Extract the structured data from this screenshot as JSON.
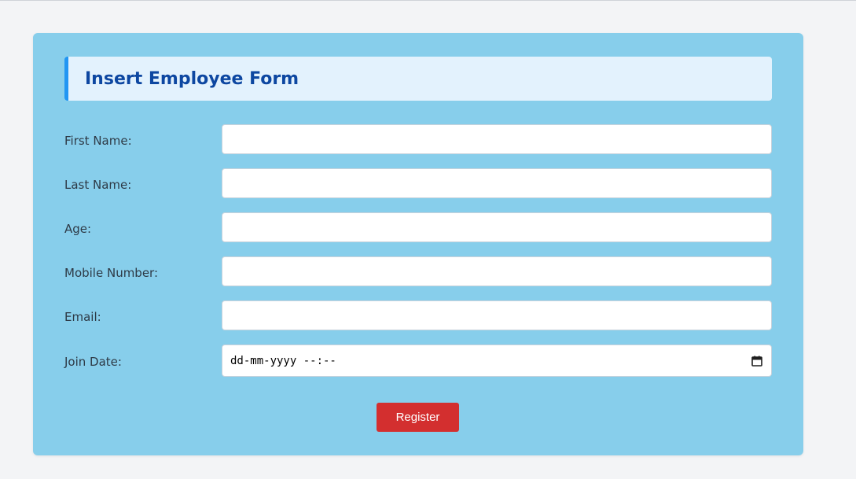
{
  "form": {
    "title": "Insert Employee Form",
    "fields": [
      {
        "label": "First Name:",
        "value": ""
      },
      {
        "label": "Last Name:",
        "value": ""
      },
      {
        "label": "Age:",
        "value": ""
      },
      {
        "label": "Mobile Number:",
        "value": ""
      },
      {
        "label": "Email:",
        "value": ""
      }
    ],
    "join_date": {
      "label": "Join Date:",
      "placeholder": "dd-mm-yyyy --:--",
      "icon": "calendar-icon"
    },
    "submit_label": "Register"
  },
  "colors": {
    "page_background": "#f3f4f6",
    "card_background": "#87ceeb",
    "title_background": "#e3f2fd",
    "title_accent": "#2196f3",
    "title_text": "#0d47a1",
    "button_background": "#d32f2f",
    "button_text": "#ffffff"
  }
}
